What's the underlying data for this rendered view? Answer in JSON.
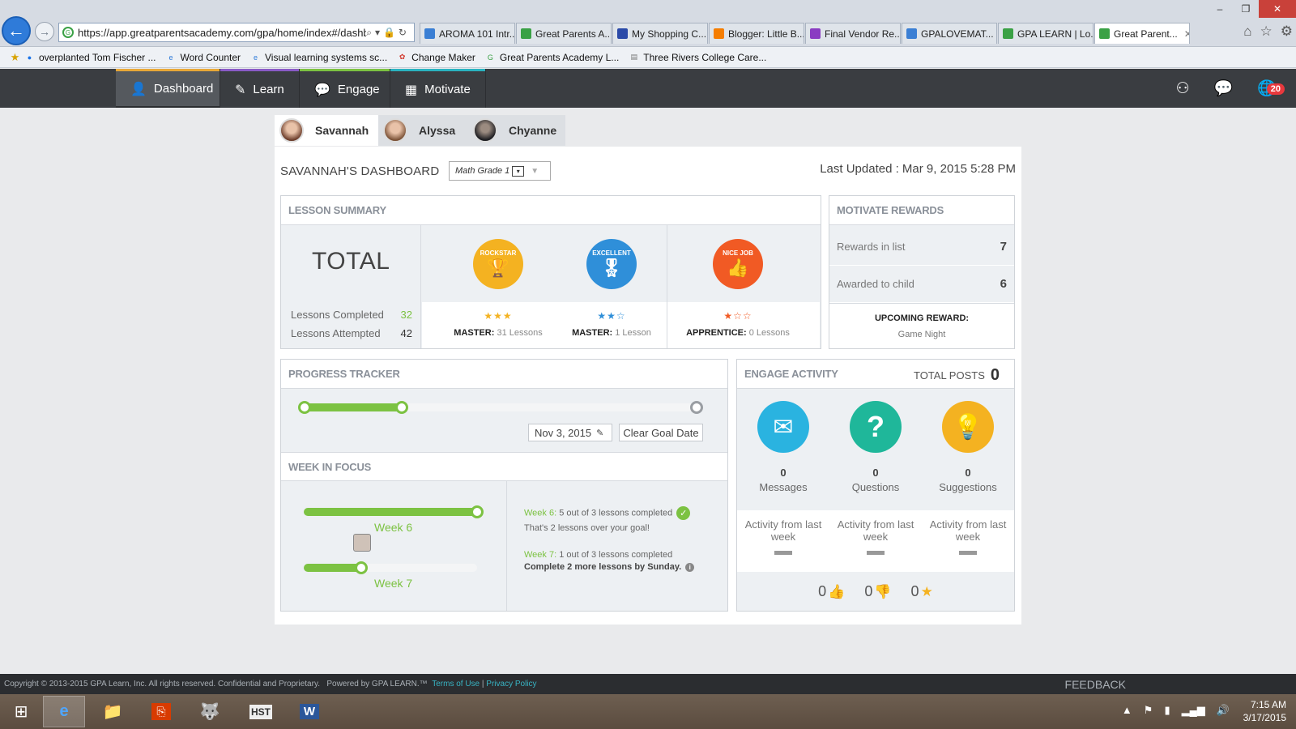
{
  "browser": {
    "url": "https://app.greatparentsacademy.com/gpa/home/index#/dashbo",
    "tabs": [
      {
        "title": "AROMA 101 Intr...",
        "icon": "ie-icon",
        "color": "#3b7fd4"
      },
      {
        "title": "Great Parents A...",
        "icon": "gpa-icon",
        "color": "#3aa145"
      },
      {
        "title": "My Shopping C...",
        "icon": "shopping-icon",
        "color": "#2b4aa8"
      },
      {
        "title": "Blogger: Little B...",
        "icon": "blogger-icon",
        "color": "#f57d00"
      },
      {
        "title": "Final Vendor Re...",
        "icon": "form-icon",
        "color": "#8a3cc2"
      },
      {
        "title": "GPALOVEMAT...",
        "icon": "ie-icon",
        "color": "#3b7fd4"
      },
      {
        "title": "GPA LEARN | Lo...",
        "icon": "gpa-icon",
        "color": "#3aa145"
      },
      {
        "title": "Great Parent...",
        "icon": "gpa-icon",
        "color": "#3aa145",
        "active": true
      }
    ],
    "favorites": [
      {
        "label": "overplanted Tom Fischer ...",
        "icon": "tilde-icon"
      },
      {
        "label": "Word Counter",
        "icon": "ie-icon"
      },
      {
        "label": "Visual learning systems sc...",
        "icon": "ie-icon"
      },
      {
        "label": "Change Maker",
        "icon": "changemaker-icon"
      },
      {
        "label": "Great Parents Academy  L...",
        "icon": "gpa-icon"
      },
      {
        "label": "Three Rivers College Care...",
        "icon": "page-icon"
      }
    ]
  },
  "nav": {
    "tabs": [
      {
        "label": "Dashboard",
        "icon": "person-icon",
        "accent": "#e8a838",
        "active": true
      },
      {
        "label": "Learn",
        "icon": "pencil-icon",
        "accent": "#8a5bc7"
      },
      {
        "label": "Engage",
        "icon": "chat-icon",
        "accent": "#7cc242"
      },
      {
        "label": "Motivate",
        "icon": "grid-icon",
        "accent": "#2ab3c0"
      }
    ],
    "notification_count": "20"
  },
  "children": [
    {
      "name": "Savannah",
      "active": true
    },
    {
      "name": "Alyssa"
    },
    {
      "name": "Chyanne"
    }
  ],
  "dashboard": {
    "title": "SAVANNAH'S DASHBOARD",
    "grade": "Math Grade 1",
    "last_updated": "Last Updated : Mar 9, 2015 5:28 PM"
  },
  "lesson_summary": {
    "heading": "LESSON SUMMARY",
    "total_label": "TOTAL",
    "completed_label": "Lessons Completed",
    "completed_value": "32",
    "attempted_label": "Lessons Attempted",
    "attempted_value": "42",
    "badges": [
      {
        "badge": "ROCKSTAR",
        "icon": "trophy-icon",
        "color": "#f4b221",
        "star_color": "#f4b221",
        "stars_filled": 3,
        "stars": "★★★",
        "level": "MASTER:",
        "lessons": "31 Lessons"
      },
      {
        "badge": "EXCELLENT",
        "icon": "ribbon-icon",
        "color": "#2f8fd9",
        "star_color": "#2f8fd9",
        "stars_filled": 2,
        "stars": "★★☆",
        "level": "MASTER:",
        "lessons": "1 Lesson"
      },
      {
        "badge": "NICE JOB",
        "icon": "thumbs-up-icon",
        "color": "#f15a24",
        "star_color": "#f15a24",
        "stars_filled": 1,
        "stars": "★☆☆",
        "level": "APPRENTICE:",
        "lessons": "0 Lessons"
      }
    ]
  },
  "motivate_rewards": {
    "heading": "MOTIVATE REWARDS",
    "rewards_in_list_label": "Rewards in list",
    "rewards_in_list": "7",
    "awarded_label": "Awarded to child",
    "awarded": "6",
    "upcoming_label": "UPCOMING REWARD:",
    "upcoming_name": "Game Night"
  },
  "progress_tracker": {
    "heading": "PROGRESS TRACKER",
    "progress_fraction": 0.25,
    "goal_date": "Nov 3, 2015",
    "clear_goal_label": "Clear Goal Date"
  },
  "week_in_focus": {
    "heading": "WEEK IN FOCUS",
    "weeks": [
      {
        "label": "Week 6",
        "fraction": 1.0
      },
      {
        "label": "Week 7",
        "fraction": 0.33
      }
    ],
    "week6_label": "Week 6:",
    "week6_text": "5 out of 3 lessons completed",
    "week6_note": "That's 2 lessons over your goal!",
    "week7_label": "Week 7:",
    "week7_text": "1 out of 3 lessons completed",
    "week7_note": "Complete 2 more lessons by Sunday."
  },
  "engage_activity": {
    "heading": "ENGAGE ACTIVITY",
    "total_posts_label": "TOTAL POSTS",
    "total_posts": "0",
    "items": [
      {
        "count": "0",
        "label": "Messages",
        "icon": "envelope-icon",
        "color": "#2ab3e0",
        "activity": "Activity from last week"
      },
      {
        "count": "0",
        "label": "Questions",
        "icon": "question-icon",
        "color": "#1fb79a",
        "activity": "Activity from last week"
      },
      {
        "count": "0",
        "label": "Suggestions",
        "icon": "lightbulb-icon",
        "color": "#f4b221",
        "activity": "Activity from last week"
      }
    ],
    "likes": "0",
    "dislikes": "0",
    "stars": "0"
  },
  "footer": {
    "copyright": "Copyright © 2013-2015 GPA Learn, Inc. All rights reserved. Confidential and Proprietary.",
    "powered": "Powered by GPA LEARN.™",
    "terms": "Terms of Use",
    "privacy": "Privacy Policy",
    "feedback": "FEEDBACK"
  },
  "taskbar": {
    "time": "7:15 AM",
    "date": "3/17/2015",
    "apps": [
      "windows-start-icon",
      "ie-icon",
      "file-explorer-icon",
      "office-icon",
      "gimp-icon",
      "hst-icon",
      "word-icon"
    ],
    "hst_label": "HST"
  }
}
